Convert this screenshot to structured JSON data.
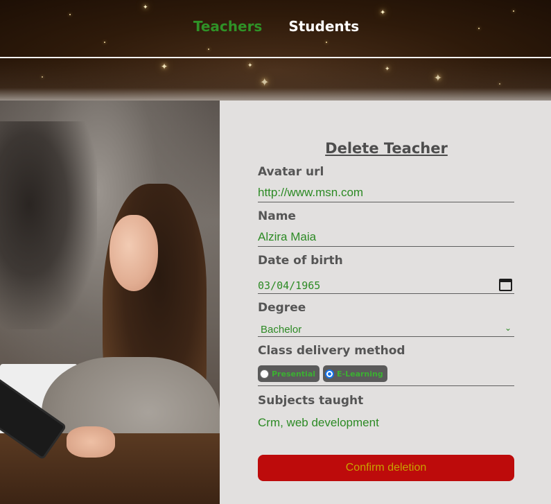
{
  "nav": {
    "items": [
      {
        "label": "Teachers",
        "active": true
      },
      {
        "label": "Students",
        "active": false
      }
    ]
  },
  "form": {
    "title": "Delete Teacher",
    "avatar": {
      "label": "Avatar url",
      "value": "http://www.msn.com"
    },
    "name": {
      "label": "Name",
      "value": "Alzira Maia"
    },
    "dob": {
      "label": "Date of birth",
      "value": "03/04/1965"
    },
    "degree": {
      "label": "Degree",
      "value": "Bachelor"
    },
    "delivery": {
      "label": "Class delivery method",
      "options": [
        {
          "label": "Presential",
          "checked": false
        },
        {
          "label": "E-Learning",
          "checked": true
        }
      ]
    },
    "subjects": {
      "label": "Subjects taught",
      "value": "Crm, web development"
    },
    "confirm_label": "Confirm deletion"
  },
  "colors": {
    "accent_green": "#2f9227",
    "danger_red": "#bd0b0b",
    "button_text": "#c8a200",
    "panel_bg": "#e2e0df"
  },
  "icons": {
    "calendar": "calendar-icon",
    "select_arrow": "chevron-down-icon"
  }
}
